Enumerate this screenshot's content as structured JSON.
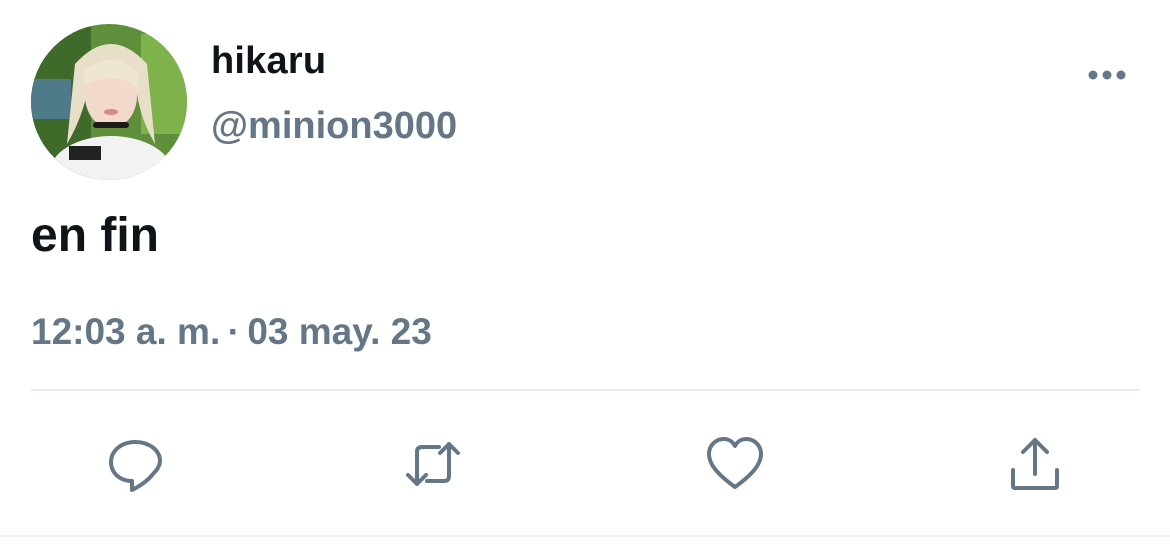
{
  "author": {
    "display_name": "hikaru",
    "handle": "@minion3000"
  },
  "tweet": {
    "text": "en fin",
    "time": "12:03 a. m.",
    "separator": "·",
    "date": "03 may. 23"
  },
  "icons": {
    "more": "more-horizontal-icon",
    "reply": "reply-icon",
    "retweet": "retweet-icon",
    "like": "heart-icon",
    "share": "share-icon"
  },
  "colors": {
    "primary_text": "#0f1419",
    "secondary_text": "#657786",
    "icon": "#657786",
    "divider": "#e6ecf0"
  }
}
